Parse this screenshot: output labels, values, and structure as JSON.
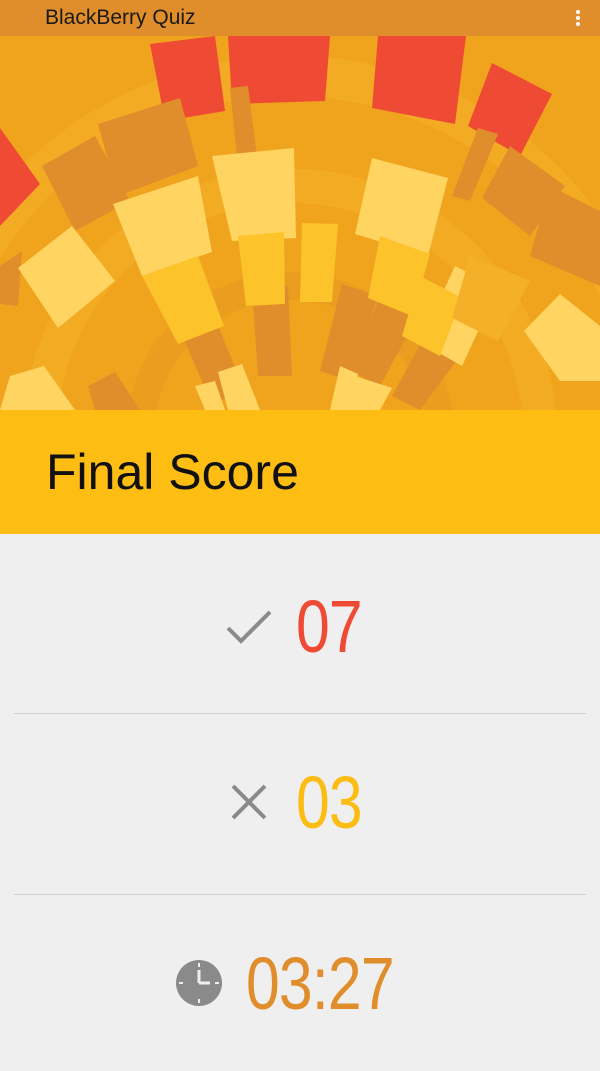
{
  "appbar": {
    "title": "BlackBerry Quiz",
    "menu_icon": "overflow-menu-icon"
  },
  "banner": {
    "title": "Final Score"
  },
  "stats": {
    "correct": {
      "icon": "checkmark-icon",
      "value": "07",
      "color": "#ef4a33"
    },
    "wrong": {
      "icon": "cross-icon",
      "value": "03",
      "color": "#fbbd14"
    },
    "time": {
      "icon": "clock-icon",
      "value": "03:27",
      "color": "#e08e2b"
    }
  },
  "colors": {
    "appbar": "#e08e2b",
    "banner": "#fdbd13",
    "hero_base": "#f0a41d",
    "tile_red": "#ef4a33",
    "tile_orange": "#e08e2b",
    "tile_yellow": "#fdc32a",
    "tile_light": "#ffd460",
    "background": "#efefef"
  }
}
